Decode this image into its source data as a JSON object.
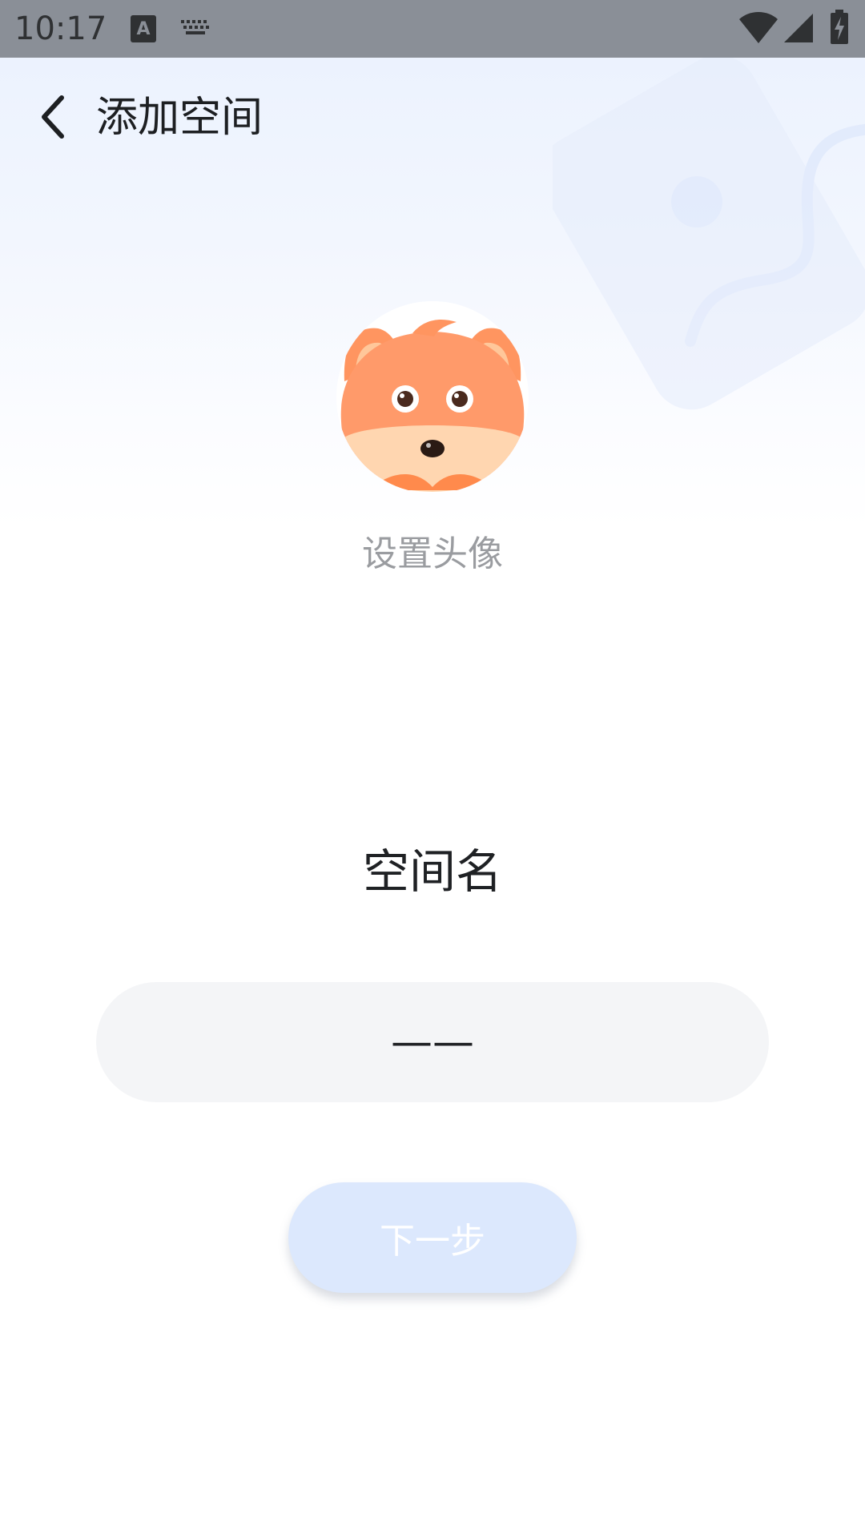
{
  "status_bar": {
    "time": "10:17",
    "icons": [
      "keyboard-a-icon",
      "keyboard-icon",
      "wifi-icon",
      "cell-signal-icon",
      "battery-charging-icon"
    ]
  },
  "header": {
    "back_icon": "chevron-left-icon",
    "title": "添加空间"
  },
  "avatar": {
    "icon": "fox-avatar-icon",
    "label": "设置头像"
  },
  "form": {
    "section_label": "空间名",
    "name_input_value": "——"
  },
  "actions": {
    "next_label": "下一步"
  },
  "colors": {
    "status_bar_bg": "#8a8f97",
    "input_bg": "#f4f5f7",
    "next_button_bg": "#dce8fd",
    "avatar_orange": "#ff8a4c"
  }
}
